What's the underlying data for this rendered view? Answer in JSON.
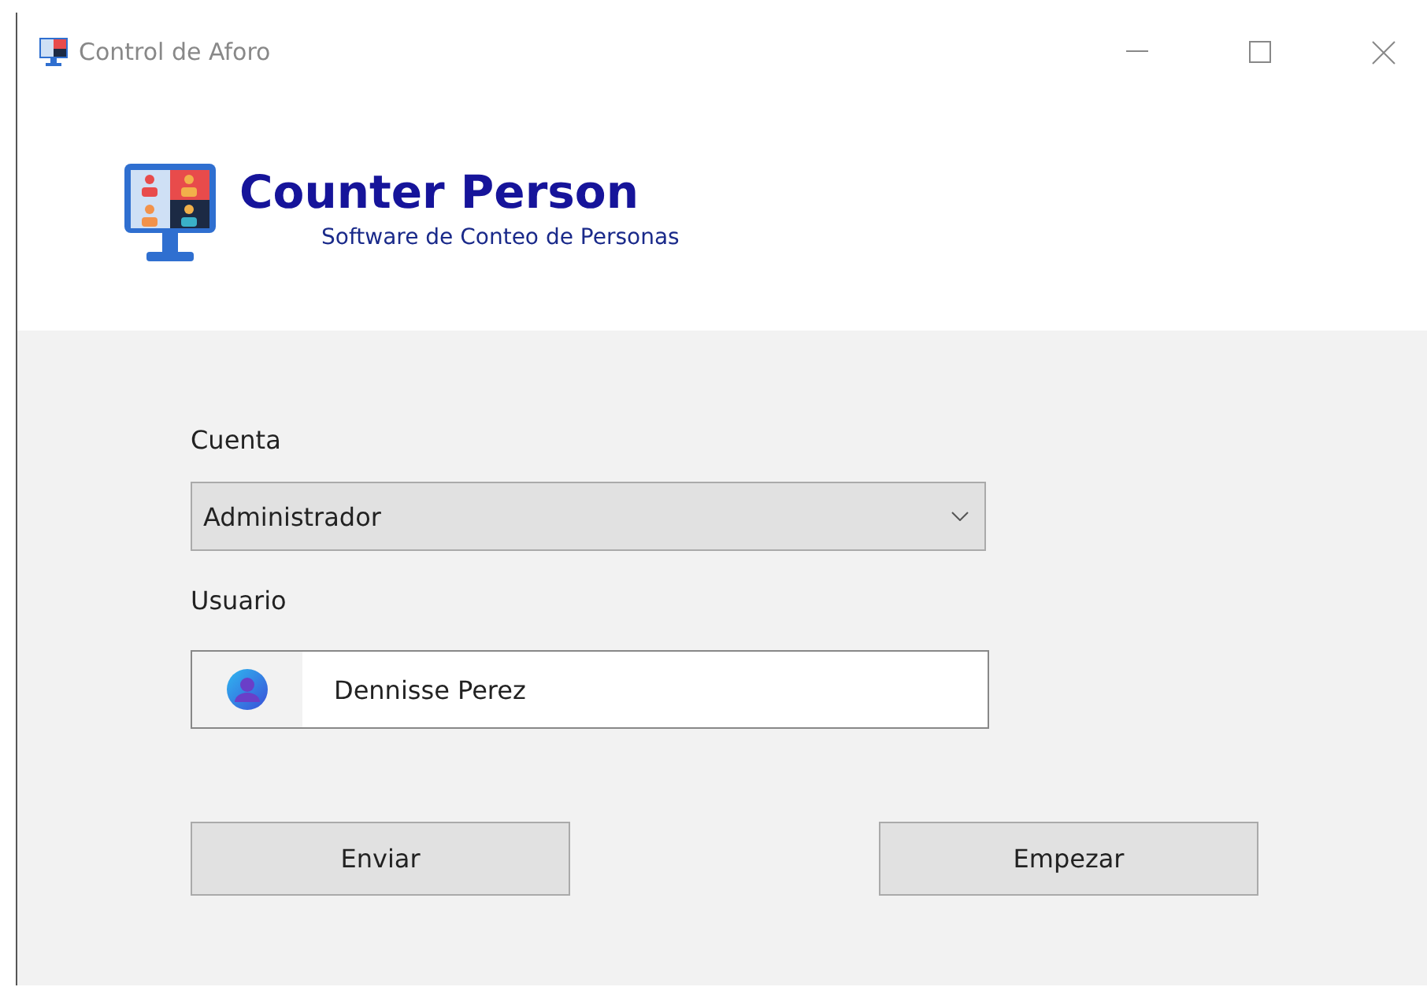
{
  "window": {
    "title": "Control de Aforo"
  },
  "header": {
    "title": "Counter Person",
    "subtitle": "Software de Conteo de Personas"
  },
  "account": {
    "label": "Cuenta",
    "value": "Administrador"
  },
  "user": {
    "label": "Usuario",
    "value": "Dennisse Perez"
  },
  "buttons": [
    "Enviar",
    "Empezar"
  ]
}
